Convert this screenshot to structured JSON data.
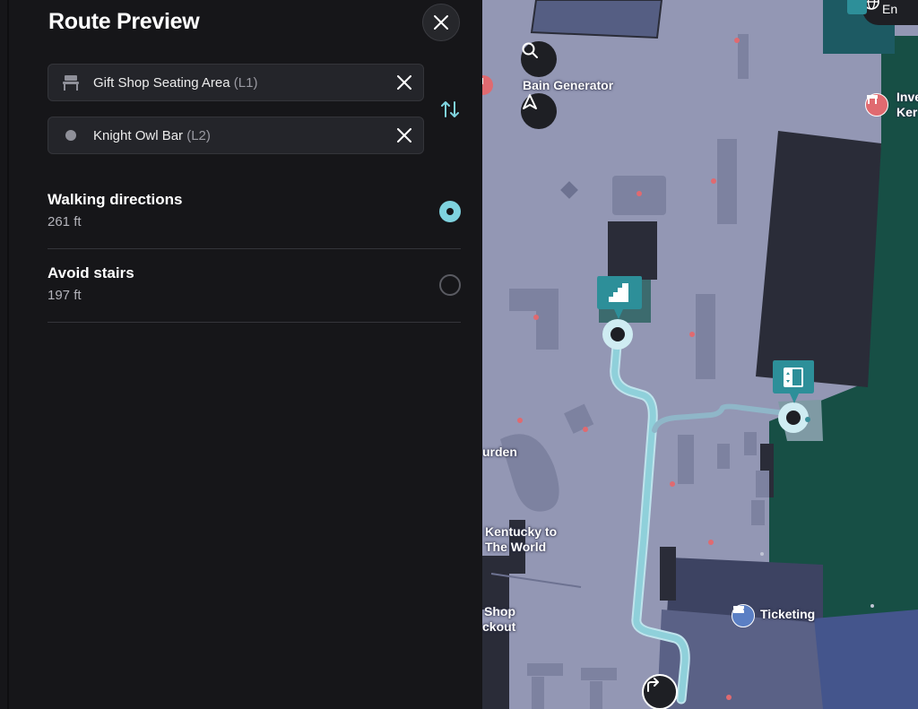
{
  "panel": {
    "title": "Route Preview",
    "from": {
      "name": "Gift Shop Seating Area",
      "level": "(L1)",
      "icon": "bench-icon"
    },
    "to": {
      "name": "Knight Owl Bar",
      "level": "(L2)",
      "icon": "dot-icon"
    },
    "options": [
      {
        "name": "Walking directions",
        "distance": "261 ft",
        "selected": true
      },
      {
        "name": "Avoid stairs",
        "distance": "197 ft",
        "selected": false
      }
    ]
  },
  "map": {
    "labels": {
      "bain": "Bain Generator",
      "inve": "Inve",
      "ker": "Ker",
      "garden": "urden",
      "kentucky_1": "Kentucky to",
      "kentucky_2": "The World",
      "shop_1": "Shop",
      "shop_2": "ckout",
      "ticketing": "Ticketing",
      "topright": "En"
    },
    "colors": {
      "route": "#8fd0da",
      "connector": "#2d8f99",
      "green_zone": "#174f45",
      "floor": "#9397b4",
      "dark_block": "#2a2c38"
    }
  }
}
